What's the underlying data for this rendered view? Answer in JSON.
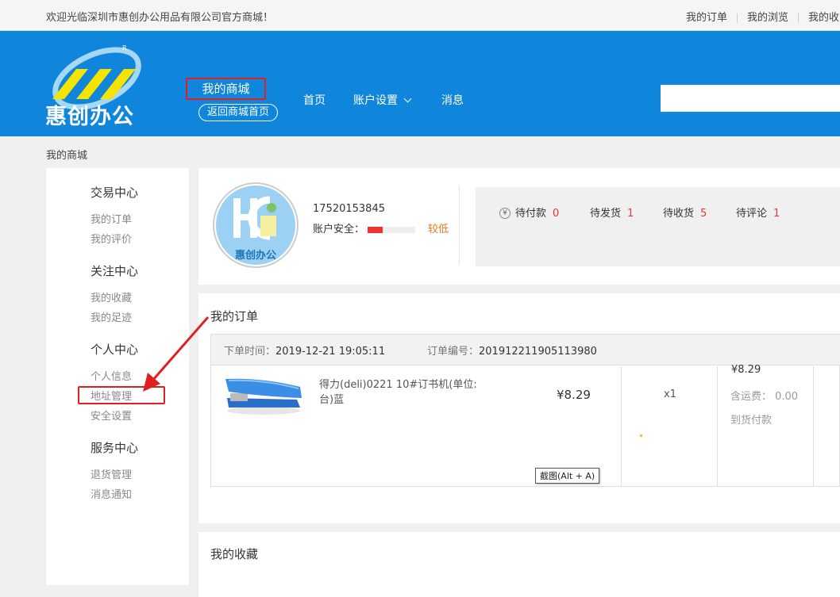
{
  "topbar": {
    "welcome": "欢迎光临深圳市惠创办公用品有限公司官方商城！",
    "links": [
      "我的订单",
      "我的浏览",
      "我的收"
    ]
  },
  "header": {
    "logo_text": "惠创办公",
    "my_mall": "我的商城",
    "back_home": "返回商城首页",
    "nav": {
      "home": "首页",
      "account": "账户设置",
      "messages": "消息"
    },
    "search_value": ""
  },
  "breadcrumb": "我的商城",
  "sidebar": {
    "groups": [
      {
        "title": "交易中心",
        "items": [
          "我的订单",
          "我的评价"
        ]
      },
      {
        "title": "关注中心",
        "items": [
          "我的收藏",
          "我的足迹"
        ]
      },
      {
        "title": "个人中心",
        "items": [
          "个人信息",
          "地址管理",
          "安全设置"
        ]
      },
      {
        "title": "服务中心",
        "items": [
          "退货管理",
          "消息通知"
        ]
      }
    ]
  },
  "profile": {
    "avatar_text": "惠创办公",
    "phone": "17520153845",
    "security_label": "账户安全：",
    "security_level": "较低",
    "security_fill": 0.32,
    "stats": [
      {
        "label": "待付款",
        "count": "0"
      },
      {
        "label": "待发货",
        "count": "1"
      },
      {
        "label": "待收货",
        "count": "5"
      },
      {
        "label": "待评论",
        "count": "1"
      }
    ]
  },
  "orders": {
    "title": "我的订单",
    "time_label": "下单时间：",
    "time": "2019-12-21 19:05:11",
    "number_label": "订单编号：",
    "number": "201912211905113980",
    "product_name": "得力(deli)0221 10#订书机(单位:台)蓝",
    "price": "¥8.29",
    "qty": "x1",
    "total": "¥8.29",
    "shipping": "含运费：  0.00",
    "payment": "到货付款",
    "tooltip": "截图(Alt + A)"
  },
  "favorites": {
    "title": "我的收藏"
  },
  "colors": {
    "header_blue": "#0f86db",
    "highlight_red": "#e02020",
    "count_red": "#e33333",
    "warning_orange": "#e27c1d"
  }
}
